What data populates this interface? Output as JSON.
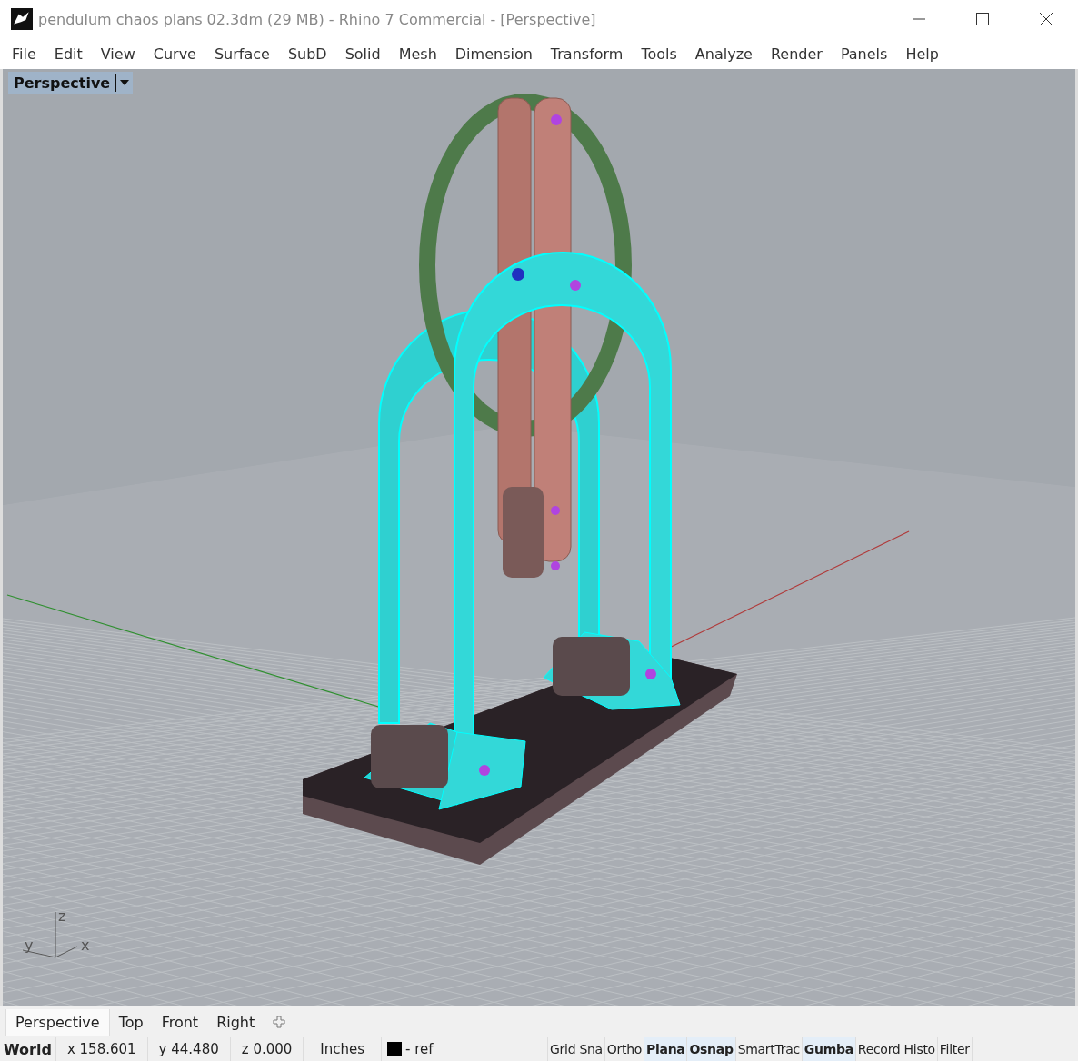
{
  "window": {
    "title": "pendulum chaos plans 02.3dm (29 MB) - Rhino 7 Commercial - [Perspective]"
  },
  "menu": [
    "File",
    "Edit",
    "View",
    "Curve",
    "Surface",
    "SubD",
    "Solid",
    "Mesh",
    "Dimension",
    "Transform",
    "Tools",
    "Analyze",
    "Render",
    "Panels",
    "Help"
  ],
  "viewport": {
    "title": "Perspective",
    "axes": {
      "z": "z",
      "y": "y",
      "x": "x"
    }
  },
  "view_tabs": [
    {
      "label": "Perspective",
      "selected": true
    },
    {
      "label": "Top",
      "selected": false
    },
    {
      "label": "Front",
      "selected": false
    },
    {
      "label": "Right",
      "selected": false
    }
  ],
  "status_bar": {
    "cplane": "World",
    "x": "x 158.601",
    "y": "y 44.480",
    "z": "z 0.000",
    "units": "Inches",
    "layer": "- ref",
    "toggles": [
      {
        "label": "Grid Sna",
        "on": false
      },
      {
        "label": "Ortho",
        "on": false
      },
      {
        "label": "Plana",
        "on": true
      },
      {
        "label": "Osnap",
        "on": true
      },
      {
        "label": "SmartTrac",
        "on": false
      },
      {
        "label": "Gumba",
        "on": true
      },
      {
        "label": "Record Histo",
        "on": false
      },
      {
        "label": "Filter",
        "on": false
      }
    ]
  }
}
